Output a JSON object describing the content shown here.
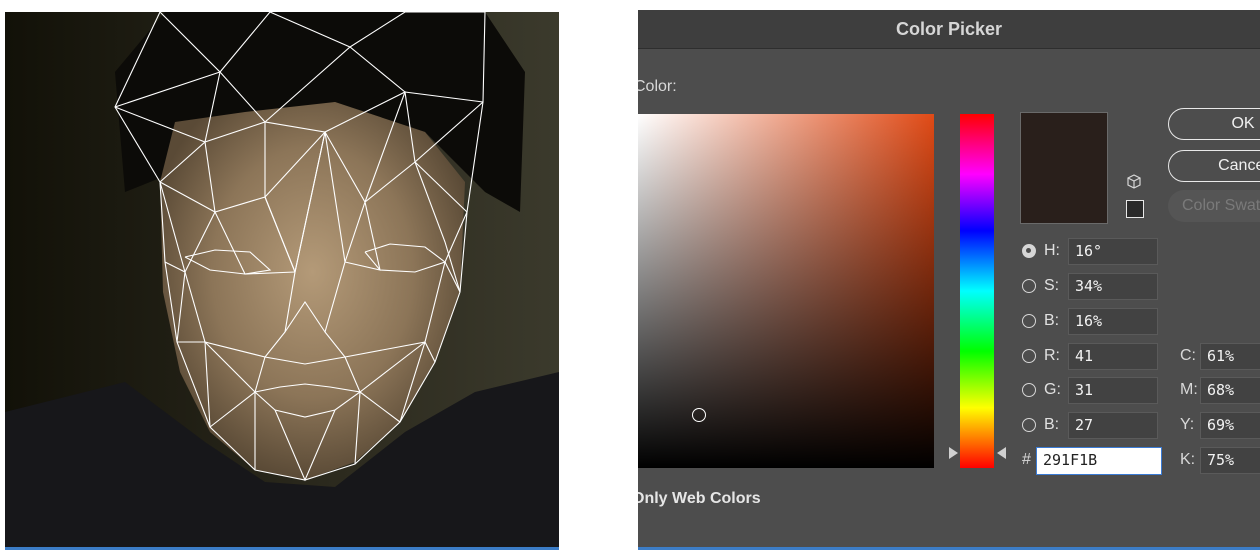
{
  "photo": {
    "description_hidden": "",
    "mesh_color": "#ffffff"
  },
  "dialog": {
    "title": "Color Picker",
    "color_label": "Color:",
    "buttons": {
      "ok": "OK",
      "cancel": "Cancel",
      "swatches": "Color Swatches"
    },
    "fields": {
      "h": {
        "label": "H:",
        "value": "16°",
        "selected": true
      },
      "s": {
        "label": "S:",
        "value": "34%"
      },
      "b": {
        "label": "B:",
        "value": "16%"
      },
      "r": {
        "label": "R:",
        "value": "41"
      },
      "g": {
        "label": "G:",
        "value": "31"
      },
      "b2": {
        "label": "B:",
        "value": "27"
      }
    },
    "cmyk": {
      "c": {
        "label": "C:",
        "value": "61%"
      },
      "m": {
        "label": "M:",
        "value": "68%"
      },
      "y": {
        "label": "Y:",
        "value": "69%"
      },
      "k": {
        "label": "K:",
        "value": "75%"
      }
    },
    "hex": {
      "symbol": "#",
      "value": "291F1B"
    },
    "web_colors_label": "Only Web Colors",
    "colors": {
      "current": "#291F1B",
      "hue_base": "#e04a16"
    }
  }
}
